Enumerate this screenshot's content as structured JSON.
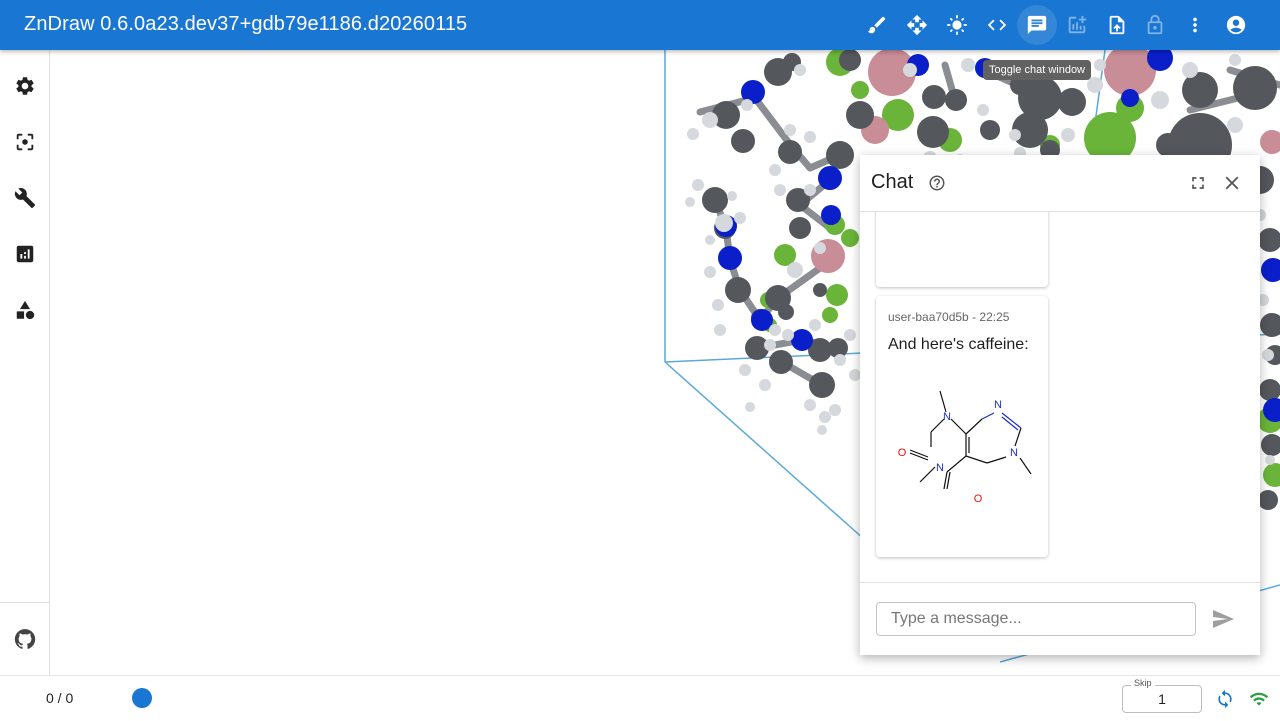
{
  "app": {
    "title": "ZnDraw 0.6.0a23.dev37+gdb79e1186.d20260115"
  },
  "toolbar": {
    "icons": [
      "brush-icon",
      "move-icon",
      "brightness-icon",
      "code-icon",
      "chat-icon",
      "add-chart-icon",
      "upload-file-icon",
      "lock-icon",
      "more-vert-icon",
      "account-circle-icon"
    ],
    "tooltip": "Toggle chat window"
  },
  "sidebar": {
    "icons": [
      "settings-icon",
      "focus-icon",
      "build-icon",
      "analytics-icon",
      "shapes-icon",
      "github-icon"
    ]
  },
  "chat": {
    "title": "Chat",
    "messages": [
      {
        "meta": "user-baa70d5b - 22:25",
        "text": "And here's caffeine:"
      }
    ],
    "molecule_atoms": {
      "n1": "N",
      "n2": "N",
      "n3": "N",
      "n4": "N",
      "o1": "O",
      "o2": "O"
    },
    "input_placeholder": "Type a message..."
  },
  "bottom": {
    "frame_count": "0 / 0",
    "skip_label": "Skip",
    "skip_value": "1"
  },
  "colors": {
    "appbar": "#1976d2",
    "carbon": "#54575c",
    "nitrogen": "#0a1fc9",
    "fluorine": "#6ab43a",
    "boron": "#c98d97",
    "hydrogen": "#d5d8dc",
    "cell": "#5aa9d8"
  }
}
